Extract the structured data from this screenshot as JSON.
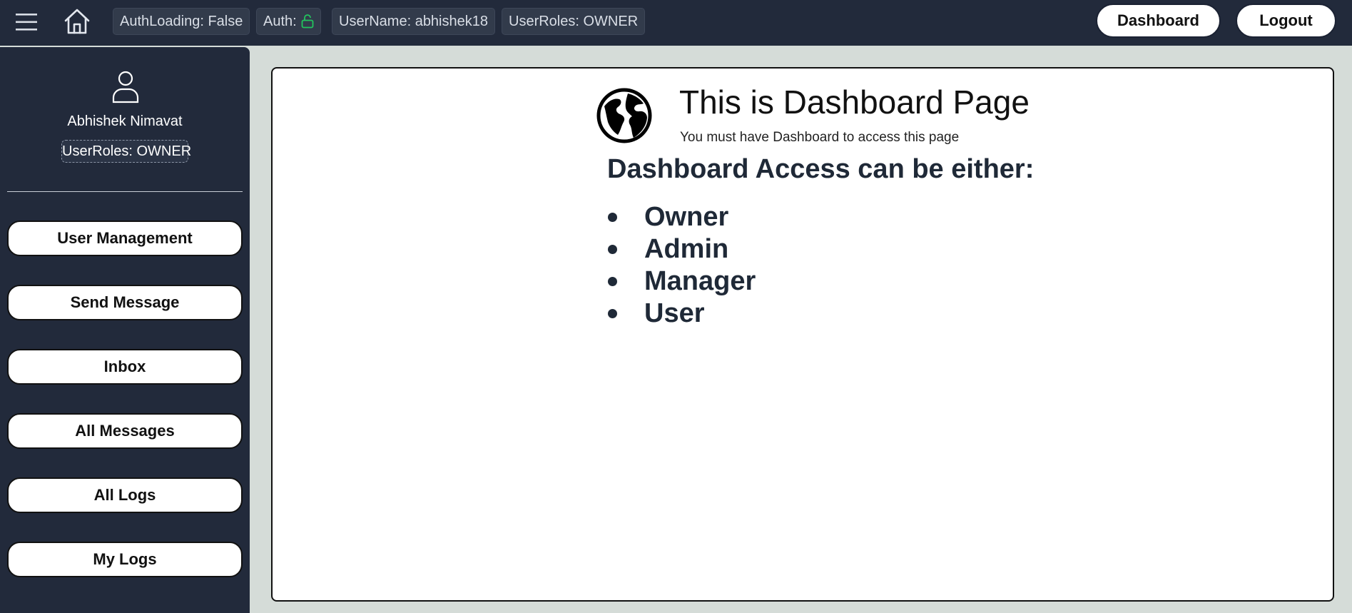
{
  "topbar": {
    "menu_icon": "hamburger-menu-icon",
    "home_icon": "home-icon",
    "chips": {
      "auth_loading": "AuthLoading: False",
      "auth": "Auth:",
      "auth_icon": "unlock-icon",
      "username": "UserName: abhishek18",
      "user_roles": "UserRoles: OWNER"
    },
    "dashboard_button": "Dashboard",
    "logout_button": "Logout"
  },
  "sidebar": {
    "avatar_icon": "user-icon",
    "name": "Abhishek Nimavat",
    "role_badge": "UserRoles: OWNER",
    "items": [
      {
        "label": "User Management"
      },
      {
        "label": "Send Message"
      },
      {
        "label": "Inbox"
      },
      {
        "label": "All Messages"
      },
      {
        "label": "All Logs"
      },
      {
        "label": "My Logs"
      }
    ]
  },
  "main": {
    "globe_icon": "globe-icon",
    "title": "This is Dashboard Page",
    "subtitle": "You must have Dashboard to access this page",
    "access_heading": "Dashboard Access can be either:",
    "access_roles": [
      "Owner",
      "Admin",
      "Manager",
      "User"
    ]
  },
  "colors": {
    "topbar_bg": "#222a3b",
    "sidebar_bg": "#222a3b",
    "page_bg": "#d5dcd8",
    "auth_icon_green": "#22c55e",
    "text_dark": "#1f2937"
  }
}
